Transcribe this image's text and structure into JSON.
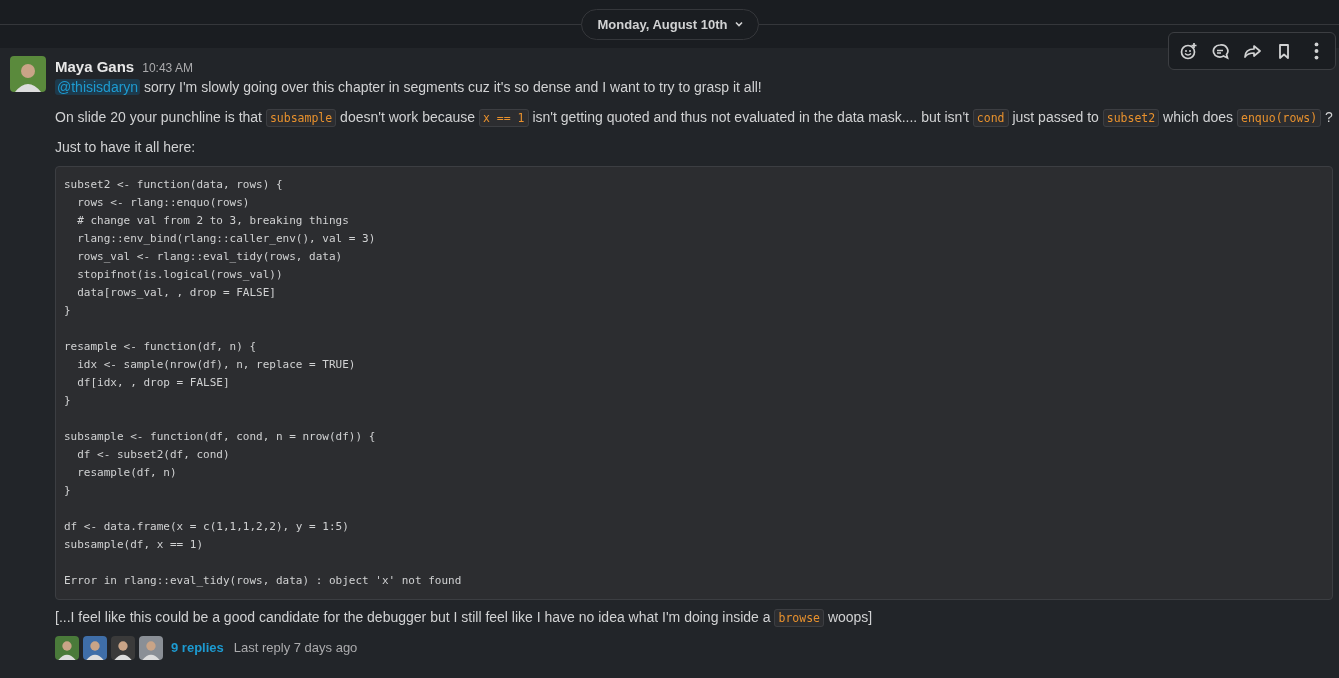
{
  "date_divider": {
    "label": "Monday, August 10th"
  },
  "message": {
    "author": "Maya Gans",
    "time": "10:43 AM",
    "paragraphs": [
      [
        {
          "kind": "mention",
          "text": "@thisisdaryn"
        },
        {
          "kind": "text",
          "text": " sorry I'm slowly going over this chapter in segments cuz it's so dense and I want to try to grasp it all!"
        }
      ],
      [
        {
          "kind": "text",
          "text": "On slide 20 your punchline is that "
        },
        {
          "kind": "code",
          "text": "subsample"
        },
        {
          "kind": "text",
          "text": " doesn't work because "
        },
        {
          "kind": "code",
          "text": "x == 1"
        },
        {
          "kind": "text",
          "text": " isn't getting quoted and thus not evaluated in the data mask.... but isn't "
        },
        {
          "kind": "code",
          "text": "cond"
        },
        {
          "kind": "text",
          "text": " just passed to "
        },
        {
          "kind": "code",
          "text": "subset2"
        },
        {
          "kind": "text",
          "text": " which does "
        },
        {
          "kind": "code",
          "text": "enquo(rows)"
        },
        {
          "kind": "text",
          "text": " ?"
        }
      ],
      [
        {
          "kind": "text",
          "text": "Just to have it all here:"
        }
      ]
    ],
    "code_block": [
      [
        "subset2 <- function(data, rows) {",
        "  rows <- rlang::enquo(rows)",
        "  # change val from 2 to 3, breaking things",
        "  rlang::env_bind(rlang::caller_env(), val = 3)",
        "  rows_val <- rlang::eval_tidy(rows, data)",
        "  stopifnot(is.logical(rows_val))",
        "  data[rows_val, , drop = FALSE]",
        "}"
      ],
      [
        "resample <- function(df, n) {",
        "  idx <- sample(nrow(df), n, replace = TRUE)",
        "  df[idx, , drop = FALSE]",
        "}"
      ],
      [
        "subsample <- function(df, cond, n = nrow(df)) {",
        "  df <- subset2(df, cond)",
        "  resample(df, n)",
        "}"
      ],
      [
        "df <- data.frame(x = c(1,1,1,2,2), y = 1:5)",
        "subsample(df, x == 1)"
      ],
      [
        "Error in rlang::eval_tidy(rows, data) : object 'x' not found"
      ]
    ],
    "after": [
      [
        {
          "kind": "text",
          "text": "[...I feel like this could be a good candidate for the debugger but I still feel like I have no idea what I'm doing inside a "
        },
        {
          "kind": "code",
          "text": "browse"
        },
        {
          "kind": "text",
          "text": " woops]"
        }
      ]
    ],
    "thread": {
      "avatars": [
        {
          "color": "#4a7a3a"
        },
        {
          "color": "#3f6ea8"
        },
        {
          "color": "#3a3a3a"
        },
        {
          "color": "#8a8f96"
        }
      ],
      "replies": "9 replies",
      "last_reply": "Last reply 7 days ago"
    }
  },
  "toolbar": [
    {
      "kind": "reaction"
    },
    {
      "kind": "thread"
    },
    {
      "kind": "share"
    },
    {
      "kind": "bookmark"
    },
    {
      "kind": "more"
    }
  ]
}
